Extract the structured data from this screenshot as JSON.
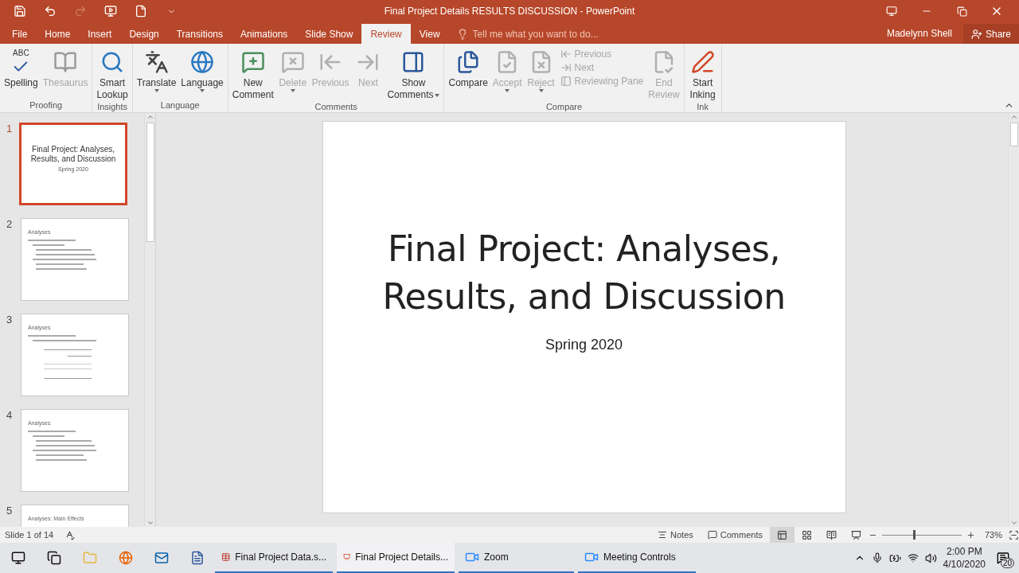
{
  "window": {
    "title": "Final Project Details RESULTS DISCUSSION - PowerPoint"
  },
  "quick_access": [
    {
      "kind": "save",
      "disabled": false
    },
    {
      "kind": "undo",
      "disabled": false
    },
    {
      "kind": "redo",
      "disabled": true
    },
    {
      "kind": "present",
      "disabled": false
    },
    {
      "kind": "new",
      "disabled": false
    },
    {
      "kind": "customize",
      "disabled": false
    }
  ],
  "tabs": [
    {
      "label": "File",
      "selected": false
    },
    {
      "label": "Home",
      "selected": false
    },
    {
      "label": "Insert",
      "selected": false
    },
    {
      "label": "Design",
      "selected": false
    },
    {
      "label": "Transitions",
      "selected": false
    },
    {
      "label": "Animations",
      "selected": false
    },
    {
      "label": "Slide Show",
      "selected": false
    },
    {
      "label": "Review",
      "selected": true
    },
    {
      "label": "View",
      "selected": false
    }
  ],
  "tell_me": {
    "placeholder": "Tell me what you want to do..."
  },
  "user": "Madelynn Shell",
  "share": "Share",
  "ribbon": [
    {
      "label": "Proofing",
      "items": [
        {
          "kind": "spelling",
          "icon_text": "ABC",
          "label": [
            "Spelling"
          ],
          "disabled": false,
          "dropdown": false
        },
        {
          "kind": "thesaurus",
          "label": [
            "Thesaurus"
          ],
          "disabled": true,
          "dropdown": false
        }
      ]
    },
    {
      "label": "Insights",
      "items": [
        {
          "kind": "lookup",
          "label": [
            "Smart",
            "Lookup"
          ],
          "disabled": false,
          "dropdown": false
        }
      ]
    },
    {
      "label": "Language",
      "items": [
        {
          "kind": "translate",
          "label": [
            "Translate"
          ],
          "disabled": false,
          "dropdown": true
        },
        {
          "kind": "language",
          "label": [
            "Language"
          ],
          "disabled": false,
          "dropdown": true
        }
      ]
    },
    {
      "label": "Comments",
      "items": [
        {
          "kind": "new-comment",
          "label": [
            "New",
            "Comment"
          ],
          "disabled": false,
          "dropdown": false
        },
        {
          "kind": "delete",
          "label": [
            "Delete"
          ],
          "disabled": true,
          "dropdown": true
        },
        {
          "kind": "previous",
          "label": [
            "Previous"
          ],
          "disabled": true,
          "dropdown": false
        },
        {
          "kind": "next",
          "label": [
            "Next"
          ],
          "disabled": true,
          "dropdown": false
        },
        {
          "kind": "show-comments",
          "label": [
            "Show",
            "Comments"
          ],
          "disabled": false,
          "dropdown": true
        }
      ]
    },
    {
      "label": "Compare",
      "items": [
        {
          "kind": "compare",
          "label": [
            "Compare"
          ],
          "disabled": false,
          "dropdown": false
        },
        {
          "kind": "accept",
          "label": [
            "Accept"
          ],
          "disabled": true,
          "dropdown": true
        },
        {
          "kind": "reject",
          "label": [
            "Reject"
          ],
          "disabled": true,
          "dropdown": true
        },
        {
          "kind": "stack",
          "buttons": [
            {
              "kind": "prev-small",
              "label": "Previous",
              "disabled": true
            },
            {
              "kind": "next-small",
              "label": "Next",
              "disabled": true
            },
            {
              "kind": "pane",
              "label": "Reviewing Pane",
              "disabled": true
            }
          ]
        },
        {
          "kind": "end-review",
          "label": [
            "End",
            "Review"
          ],
          "disabled": true,
          "dropdown": false
        }
      ]
    },
    {
      "label": "Ink",
      "items": [
        {
          "kind": "inking",
          "label": [
            "Start",
            "Inking"
          ],
          "disabled": false,
          "dropdown": false
        }
      ]
    }
  ],
  "slides": [
    {
      "number": "1",
      "selected": true,
      "kind": "title",
      "title": "Final Project: Analyses, Results, and Discussion",
      "subtitle": "Spring 2020"
    },
    {
      "number": "2",
      "selected": false,
      "kind": "bullets",
      "title": "Analyses"
    },
    {
      "number": "3",
      "selected": false,
      "kind": "table",
      "title": "Analyses"
    },
    {
      "number": "4",
      "selected": false,
      "kind": "bullets",
      "title": "Analyses"
    },
    {
      "number": "5",
      "selected": false,
      "kind": "heading",
      "title": "Analyses: Main Effects"
    }
  ],
  "current_slide": {
    "title": "Final Project: Analyses, Results, and Discussion",
    "subtitle": "Spring 2020"
  },
  "status_bar": {
    "slide_info": "Slide 1 of 14",
    "notes": "Notes",
    "comments": "Comments",
    "views": [
      {
        "kind": "normal",
        "selected": true
      },
      {
        "kind": "sorter",
        "selected": false
      },
      {
        "kind": "reading",
        "selected": false
      },
      {
        "kind": "show",
        "selected": false
      }
    ],
    "zoom": {
      "level": 0.4,
      "reading": "73%"
    }
  },
  "taskbar": {
    "pinned": [
      {
        "kind": "start"
      },
      {
        "kind": "task-view"
      },
      {
        "kind": "explorer"
      },
      {
        "kind": "firefox"
      },
      {
        "kind": "outlook"
      },
      {
        "kind": "word"
      }
    ],
    "windows": [
      {
        "kind": "spreadsheet",
        "label": "Final Project Data.s...",
        "selected": false
      },
      {
        "kind": "powerpoint",
        "label": "Final Project Details...",
        "selected": true
      },
      {
        "kind": "zoom",
        "label": "Zoom",
        "selected": false
      },
      {
        "kind": "zoom",
        "label": "Meeting Controls",
        "selected": false
      }
    ],
    "clock": {
      "time": "2:00 PM",
      "date": "4/10/2020"
    },
    "notifications": "20"
  }
}
